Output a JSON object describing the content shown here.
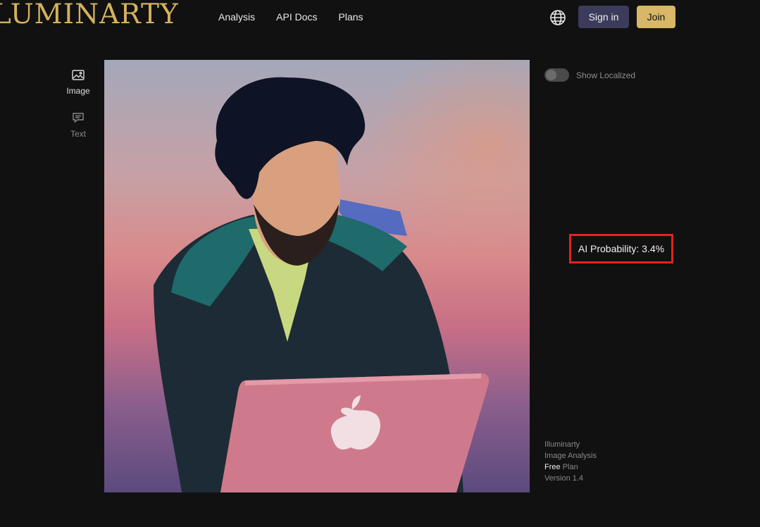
{
  "header": {
    "logo": "LUMINARTY",
    "nav": [
      "Analysis",
      "API Docs",
      "Plans"
    ],
    "language_icon": "globe-icon",
    "sign_in_label": "Sign in",
    "join_label": "Join"
  },
  "sidebar": {
    "items": [
      {
        "label": "Image",
        "icon": "image-icon",
        "active": true
      },
      {
        "label": "Text",
        "icon": "chat-icon",
        "active": false
      }
    ]
  },
  "main": {
    "image_alt": "Illustration of a bearded man using a laptop"
  },
  "panel": {
    "toggle_label": "Show Localized",
    "toggle_on": false,
    "probability_text": "AI Probability: 3.4%",
    "info": {
      "app": "Illuminarty",
      "mode": "Image Analysis",
      "plan": "Free",
      "plan_suffix": "Plan",
      "version": "Version 1.4"
    }
  },
  "colors": {
    "background": "#111111",
    "brand_gold": "#d4b25e",
    "signin_bg": "#3b3c5c",
    "join_bg": "#d9b768",
    "highlight_red": "#e3231f"
  }
}
